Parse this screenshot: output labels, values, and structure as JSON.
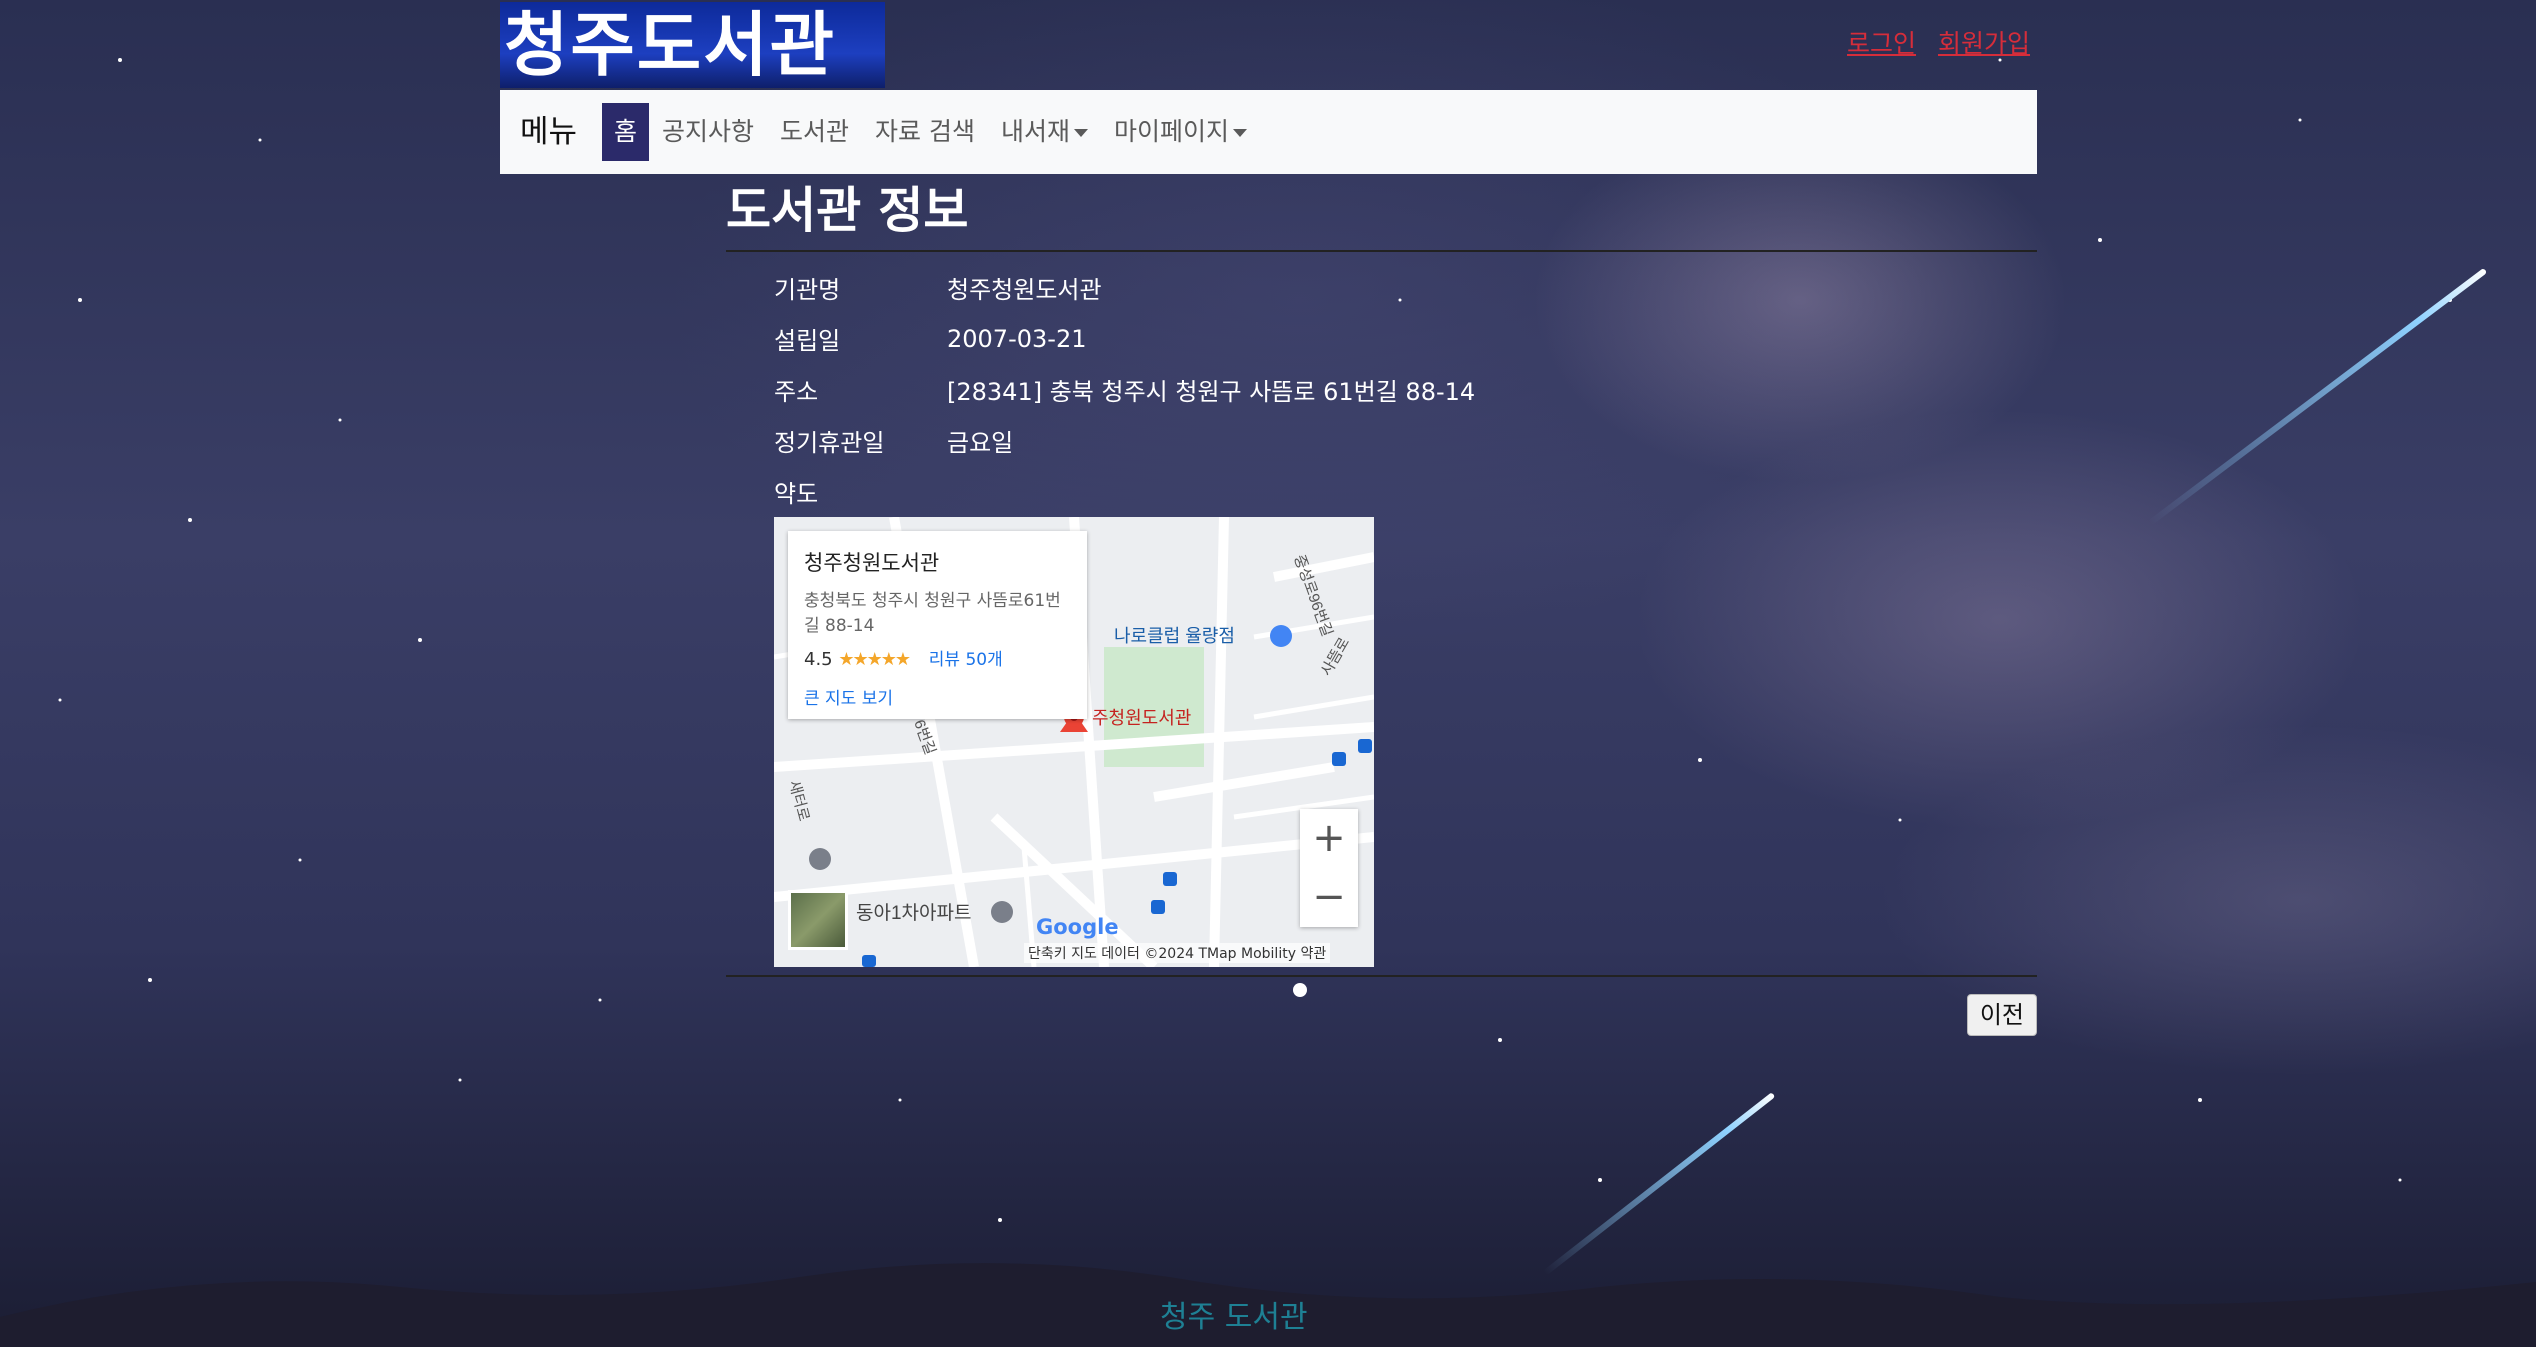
{
  "header": {
    "logo_text": "청주도서관",
    "login": "로그인",
    "signup": "회원가입"
  },
  "nav": {
    "brand": "메뉴",
    "items": [
      {
        "label": "홈"
      },
      {
        "label": "공지사항"
      },
      {
        "label": "도서관"
      },
      {
        "label": "자료 검색"
      },
      {
        "label": "내서재"
      },
      {
        "label": "마이페이지"
      }
    ]
  },
  "page": {
    "title": "도서관 정보",
    "fields": [
      {
        "label": "기관명",
        "value": "청주청원도서관"
      },
      {
        "label": "설립일",
        "value": "2007-03-21"
      },
      {
        "label": "주소",
        "value": "[28341] 충북 청주시 청원구 사뜸로 61번길 88-14"
      },
      {
        "label": "정기휴관일",
        "value": "금요일"
      },
      {
        "label": "약도",
        "value": ""
      }
    ],
    "prev_button": "이전"
  },
  "map": {
    "place_name": "청주청원도서관",
    "address": "충청북도 청주시 청원구 사뜸로61번길 88-14",
    "rating": "4.5",
    "stars": "★★★★★",
    "reviews": "리뷰 50개",
    "view_larger": "큰 지도 보기",
    "pin_label": "주청원도서관",
    "poi_store": "나로클럽 율량점",
    "poi_apartment": "동아1차아파트",
    "road1": "중성로96번길",
    "road2": "사뜸로",
    "road3": "6번길",
    "road4": "새터로",
    "google": "Google",
    "attribution": "단축키  지도 데이터 ©2024 TMap Mobility   약관",
    "zoom_in": "+",
    "zoom_out": "−"
  },
  "footer": {
    "text1": "청주",
    "text2": "도서관"
  }
}
